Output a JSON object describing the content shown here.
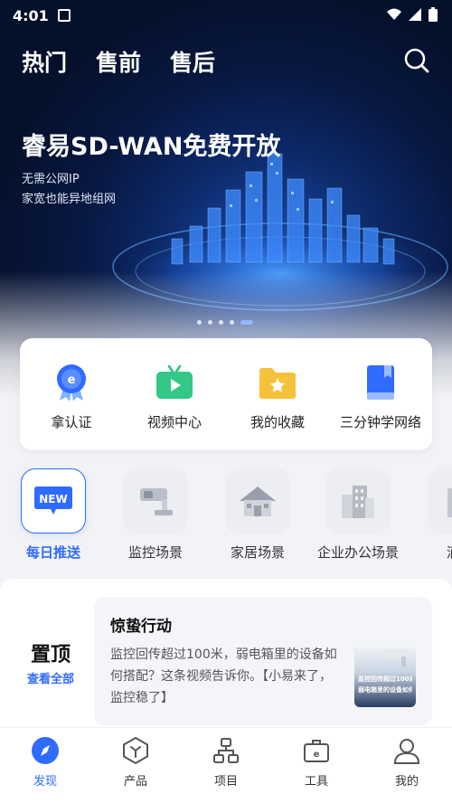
{
  "status_bar": {
    "time": "4:01"
  },
  "header": {
    "tabs": [
      {
        "label": "热门"
      },
      {
        "label": "售前"
      },
      {
        "label": "售后"
      }
    ]
  },
  "banner": {
    "title": "睿易SD-WAN免费开放",
    "subtitle_lines": [
      "无需公网IP",
      "家宽也能异地组网"
    ],
    "page_count": 5,
    "active_page": 5
  },
  "quick_links": [
    {
      "label": "拿认证",
      "icon": "certification-badge-icon"
    },
    {
      "label": "视频中心",
      "icon": "tv-play-icon"
    },
    {
      "label": "我的收藏",
      "icon": "star-folder-icon"
    },
    {
      "label": "三分钟学网络",
      "icon": "book-icon"
    }
  ],
  "scenes": [
    {
      "label": "每日推送",
      "icon": "new-badge-icon",
      "active": true,
      "badge": "NEW"
    },
    {
      "label": "监控场景",
      "icon": "camera-icon",
      "active": false
    },
    {
      "label": "家居场景",
      "icon": "house-icon",
      "active": false
    },
    {
      "label": "企业办公场景",
      "icon": "office-building-icon",
      "active": false
    },
    {
      "label": "酒店",
      "icon": "hotel-icon",
      "active": false
    }
  ],
  "pinned": {
    "title": "置顶",
    "view_all": "查看全部",
    "article": {
      "title": "惊蛰行动",
      "body": "监控回传超过100米，弱电箱里的设备如何搭配？这条视频告诉你。【小易来了，监控稳了】",
      "thumb_lines": [
        "监控回传超过100米",
        "弱电箱里的设备如何搭配"
      ]
    }
  },
  "bottom_nav": [
    {
      "label": "发现",
      "icon": "compass-icon",
      "active": true
    },
    {
      "label": "产品",
      "icon": "product-hex-icon",
      "active": false
    },
    {
      "label": "项目",
      "icon": "network-topology-icon",
      "active": false
    },
    {
      "label": "工具",
      "icon": "toolbox-icon",
      "active": false
    },
    {
      "label": "我的",
      "icon": "user-icon",
      "active": false
    }
  ],
  "colors": {
    "accent": "#2f6bff",
    "hero_bg": "#081842",
    "page_bg": "#f2f3f6"
  }
}
